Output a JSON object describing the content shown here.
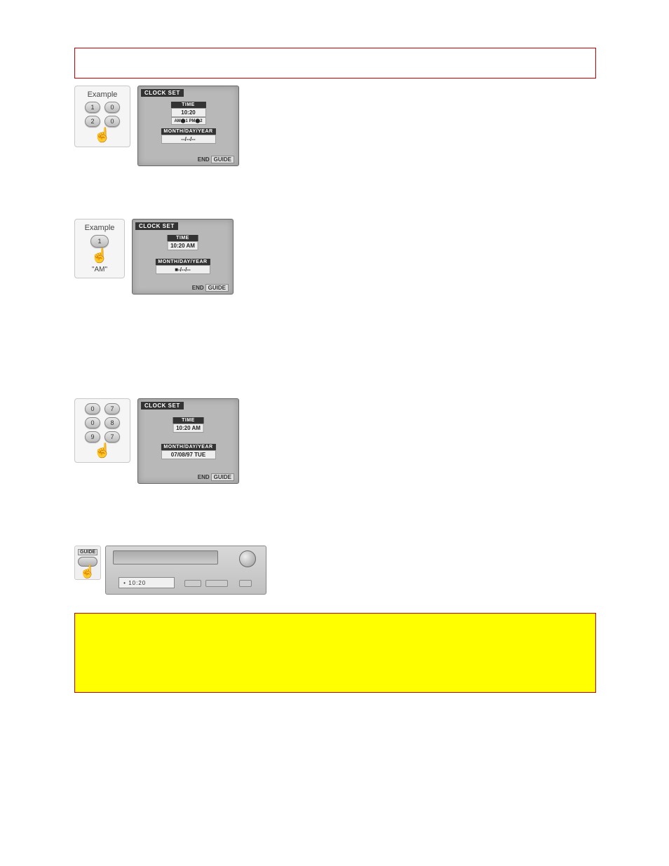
{
  "boxes": {
    "top_red": "",
    "yellow": ""
  },
  "fig1": {
    "example": "Example",
    "keys": [
      "1",
      "0",
      "2",
      "0"
    ],
    "screen_title": "CLOCK SET",
    "time_header": "TIME",
    "time_value": "10:20",
    "ampm_row": "AM⬤1 PM⬤2",
    "date_header": "MONTH/DAY/YEAR",
    "date_value": "--/--/--",
    "end": "END",
    "guide": "GUIDE"
  },
  "fig2": {
    "example": "Example",
    "key": "1",
    "am": "\"AM\"",
    "screen_title": "CLOCK SET",
    "time_header": "TIME",
    "time_value": "10:20 AM",
    "date_header": "MONTH/DAY/YEAR",
    "date_value": "■-/--/--",
    "end": "END",
    "guide": "GUIDE"
  },
  "fig3": {
    "keys": [
      "0",
      "7",
      "0",
      "8",
      "9",
      "7"
    ],
    "screen_title": "CLOCK SET",
    "time_header": "TIME",
    "time_value": "10:20 AM",
    "date_header": "MONTH/DAY/YEAR",
    "date_value": "07/08/97 TUE",
    "end": "END",
    "guide": "GUIDE"
  },
  "fig4": {
    "guide_label": "GUIDE",
    "display": "• 10:20"
  }
}
